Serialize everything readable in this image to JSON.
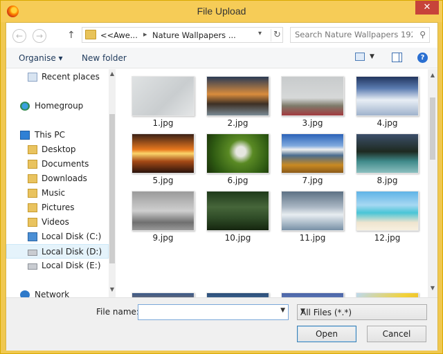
{
  "window": {
    "title": "File Upload",
    "close_label": "✕"
  },
  "nav": {
    "back_label": "←",
    "forward_label": "→",
    "up_label": "↑",
    "address": {
      "overflow": "<<",
      "crumb1": "Awe...",
      "crumb2": "Nature Wallpapers ..."
    },
    "search_placeholder": "Search Nature Wallpapers 192..."
  },
  "commands": {
    "organise": "Organise ▾",
    "new_folder": "New folder"
  },
  "sidebar": {
    "items": [
      {
        "label": "Recent places",
        "icon": "recent-places-icon"
      },
      {
        "label": "Homegroup",
        "icon": "homegroup-icon"
      },
      {
        "label": "This PC",
        "icon": "computer-icon"
      },
      {
        "label": "Desktop",
        "icon": "folder-icon"
      },
      {
        "label": "Documents",
        "icon": "folder-icon"
      },
      {
        "label": "Downloads",
        "icon": "folder-icon"
      },
      {
        "label": "Music",
        "icon": "folder-icon"
      },
      {
        "label": "Pictures",
        "icon": "folder-icon"
      },
      {
        "label": "Videos",
        "icon": "folder-icon"
      },
      {
        "label": "Local Disk (C:)",
        "icon": "windows-drive-icon"
      },
      {
        "label": "Local Disk (D:)",
        "icon": "drive-icon",
        "selected": true
      },
      {
        "label": "Local Disk (E:)",
        "icon": "drive-icon"
      },
      {
        "label": "Network",
        "icon": "network-icon"
      }
    ]
  },
  "files": [
    {
      "name": "1.jpg"
    },
    {
      "name": "2.jpg"
    },
    {
      "name": "3.jpg"
    },
    {
      "name": "4.jpg"
    },
    {
      "name": "5.jpg"
    },
    {
      "name": "6.jpg"
    },
    {
      "name": "7.jpg"
    },
    {
      "name": "8.jpg"
    },
    {
      "name": "9.jpg"
    },
    {
      "name": "10.jpg"
    },
    {
      "name": "11.jpg"
    },
    {
      "name": "12.jpg"
    },
    {
      "name": ""
    },
    {
      "name": ""
    },
    {
      "name": ""
    },
    {
      "name": ""
    }
  ],
  "footer": {
    "file_name_label": "File name:",
    "file_name_value": "",
    "file_type": "All Files (*.*)",
    "open_label": "Open",
    "cancel_label": "Cancel"
  },
  "colors": {
    "titlebar": "#f6cc57",
    "close": "#c7433a",
    "selection": "#e5f3fb"
  }
}
